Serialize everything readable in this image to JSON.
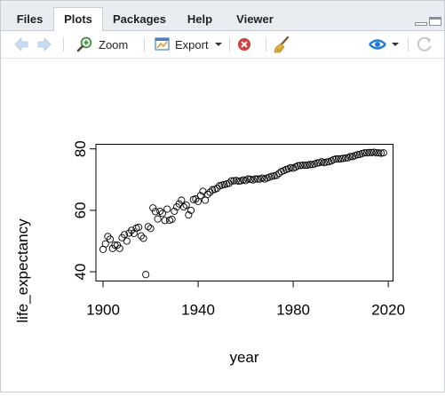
{
  "tabs": [
    {
      "label": "Files"
    },
    {
      "label": "Plots"
    },
    {
      "label": "Packages"
    },
    {
      "label": "Help"
    },
    {
      "label": "Viewer"
    }
  ],
  "active_tab": "Plots",
  "toolbar": {
    "zoom_label": "Zoom",
    "export_label": "Export"
  },
  "icons": [
    "back-arrow-icon",
    "forward-arrow-icon",
    "zoom-icon",
    "export-icon",
    "remove-plot-icon",
    "broom-icon",
    "publish-icon",
    "refresh-icon",
    "minimize-icon",
    "maximize-icon"
  ],
  "colors": {
    "tabbar_bg": "#e9edf2",
    "border": "#c9cdd3",
    "remove_red": "#d43b3b",
    "publish_blue": "#1f7bd6"
  },
  "chart_data": {
    "type": "scatter",
    "xlabel": "year",
    "ylabel": "life_expectancy",
    "xticks": [
      1900,
      1940,
      1980,
      2020
    ],
    "yticks": [
      40,
      60,
      80
    ],
    "xlim": [
      1897,
      2022
    ],
    "ylim": [
      37,
      81.5
    ],
    "marker": "open-circle",
    "x": [
      1900,
      1901,
      1902,
      1903,
      1904,
      1905,
      1906,
      1907,
      1908,
      1909,
      1910,
      1911,
      1912,
      1913,
      1914,
      1915,
      1916,
      1917,
      1918,
      1919,
      1920,
      1921,
      1922,
      1923,
      1924,
      1925,
      1926,
      1927,
      1928,
      1929,
      1930,
      1931,
      1932,
      1933,
      1934,
      1935,
      1936,
      1937,
      1938,
      1939,
      1940,
      1941,
      1942,
      1943,
      1944,
      1945,
      1946,
      1947,
      1948,
      1949,
      1950,
      1951,
      1952,
      1953,
      1954,
      1955,
      1956,
      1957,
      1958,
      1959,
      1960,
      1961,
      1962,
      1963,
      1964,
      1965,
      1966,
      1967,
      1968,
      1969,
      1970,
      1971,
      1972,
      1973,
      1974,
      1975,
      1976,
      1977,
      1978,
      1979,
      1980,
      1981,
      1982,
      1983,
      1984,
      1985,
      1986,
      1987,
      1988,
      1989,
      1990,
      1991,
      1992,
      1993,
      1994,
      1995,
      1996,
      1997,
      1998,
      1999,
      2000,
      2001,
      2002,
      2003,
      2004,
      2005,
      2006,
      2007,
      2008,
      2009,
      2010,
      2011,
      2012,
      2013,
      2014,
      2015,
      2016,
      2017,
      2018
    ],
    "y": [
      47.3,
      49.1,
      51.5,
      50.6,
      47.6,
      48.7,
      48.7,
      47.6,
      51.1,
      52.1,
      50.0,
      52.6,
      53.5,
      52.5,
      54.2,
      54.5,
      51.7,
      50.9,
      39.1,
      54.7,
      54.1,
      60.8,
      59.6,
      57.2,
      59.7,
      59.0,
      56.7,
      60.4,
      56.8,
      57.1,
      59.7,
      61.1,
      62.1,
      63.3,
      61.1,
      61.7,
      58.5,
      60.0,
      63.5,
      63.7,
      62.9,
      64.8,
      66.2,
      63.3,
      65.2,
      65.9,
      66.7,
      66.8,
      67.2,
      68.0,
      68.2,
      68.4,
      68.6,
      68.8,
      69.6,
      69.6,
      69.7,
      69.5,
      69.6,
      69.9,
      69.7,
      70.2,
      70.1,
      69.9,
      70.2,
      70.2,
      70.2,
      70.5,
      70.2,
      70.5,
      70.8,
      71.1,
      71.2,
      71.4,
      72.0,
      72.6,
      72.9,
      73.3,
      73.5,
      73.9,
      73.7,
      74.1,
      74.5,
      74.6,
      74.7,
      74.7,
      74.7,
      74.9,
      74.9,
      75.1,
      75.4,
      75.5,
      75.8,
      75.5,
      75.7,
      75.8,
      76.1,
      76.5,
      76.7,
      76.7,
      76.8,
      76.9,
      77.0,
      77.1,
      77.5,
      77.5,
      77.8,
      78.1,
      78.2,
      78.5,
      78.7,
      78.7,
      78.8,
      78.8,
      78.9,
      78.7,
      78.7,
      78.6,
      78.7
    ]
  }
}
